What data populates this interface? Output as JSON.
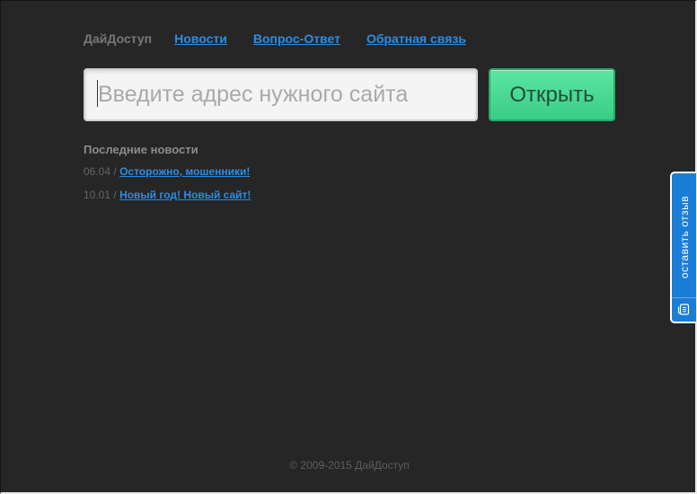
{
  "nav": {
    "brand": "ДайДоступ",
    "links": [
      "Новости",
      "Вопрос-Ответ",
      "Обратная связь"
    ]
  },
  "search": {
    "placeholder": "Введите адрес нужного сайта",
    "value": "",
    "button_label": "Открыть"
  },
  "news": {
    "heading": "Последние новости",
    "items": [
      {
        "date": "06.04",
        "separator": "/",
        "title": "Осторожно, мошенники!"
      },
      {
        "date": "10.01",
        "separator": "/",
        "title": "Новый год! Новый сайт!"
      }
    ]
  },
  "footer": {
    "copyright": "© 2009-2015 ДайДоступ"
  },
  "feedback_tab": {
    "label": "оставить отзыв",
    "icon": "feedback-icon"
  },
  "colors": {
    "background": "#262626",
    "link": "#2b8de6",
    "button": "#3ed08b",
    "feedback_tab": "#1a7dd6"
  }
}
